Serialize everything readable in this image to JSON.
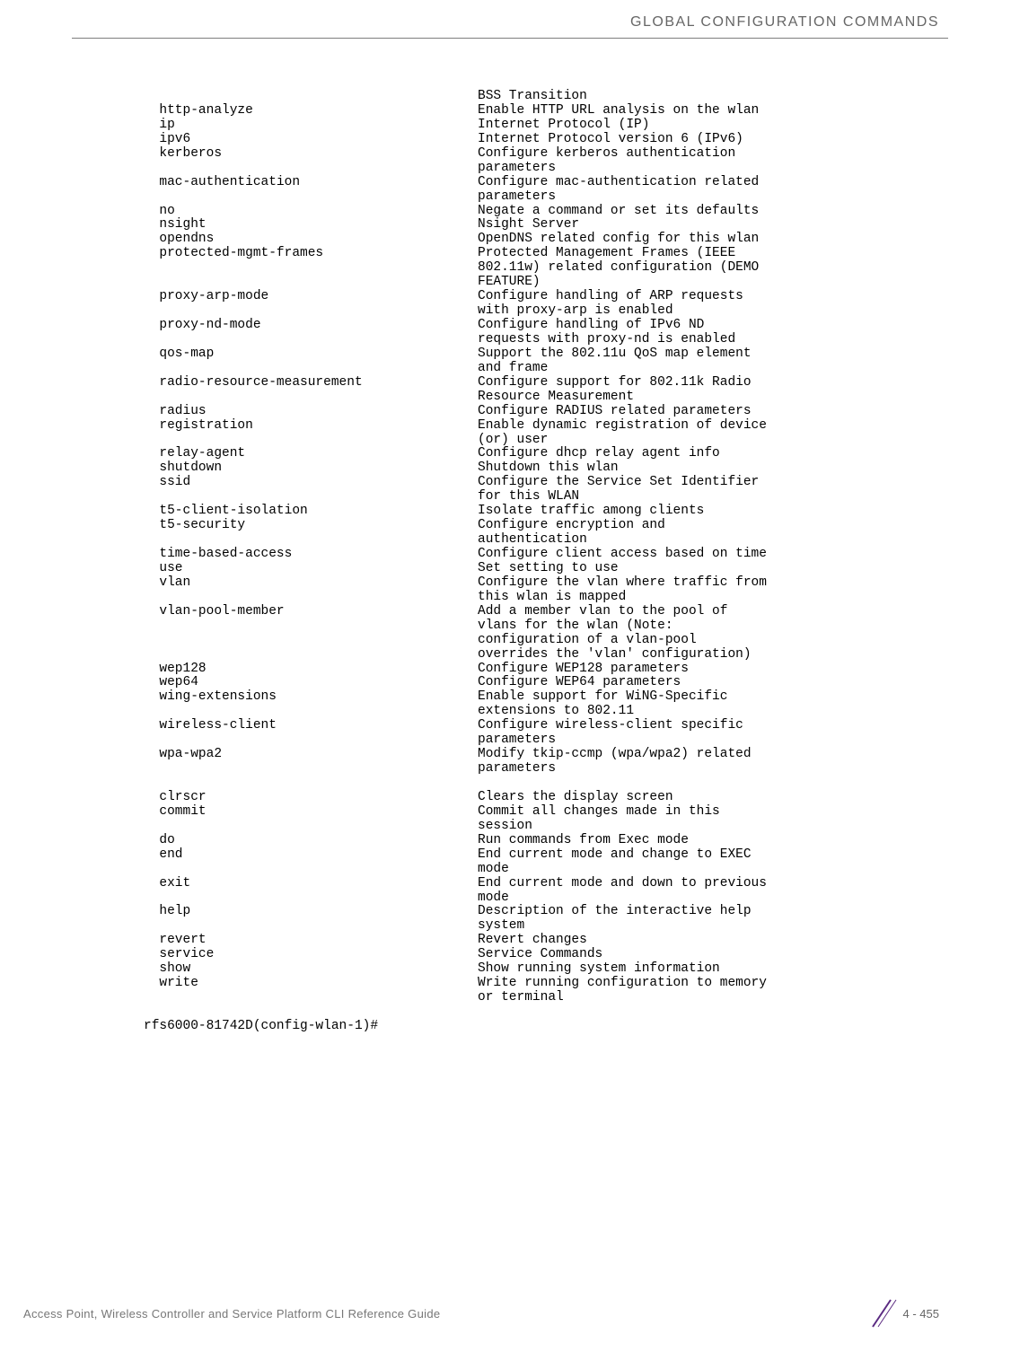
{
  "header": {
    "title": "GLOBAL CONFIGURATION COMMANDS"
  },
  "commands": [
    {
      "name": "",
      "desc": "BSS Transition"
    },
    {
      "name": "http-analyze",
      "desc": "Enable HTTP URL analysis on the wlan"
    },
    {
      "name": "ip",
      "desc": "Internet Protocol (IP)"
    },
    {
      "name": "ipv6",
      "desc": "Internet Protocol version 6 (IPv6)"
    },
    {
      "name": "kerberos",
      "desc": "Configure kerberos authentication\nparameters"
    },
    {
      "name": "mac-authentication",
      "desc": "Configure mac-authentication related\nparameters"
    },
    {
      "name": "no",
      "desc": "Negate a command or set its defaults"
    },
    {
      "name": "nsight",
      "desc": "Nsight Server"
    },
    {
      "name": "opendns",
      "desc": "OpenDNS related config for this wlan"
    },
    {
      "name": "protected-mgmt-frames",
      "desc": "Protected Management Frames (IEEE\n802.11w) related configuration (DEMO\nFEATURE)"
    },
    {
      "name": "proxy-arp-mode",
      "desc": "Configure handling of ARP requests\nwith proxy-arp is enabled"
    },
    {
      "name": "proxy-nd-mode",
      "desc": "Configure handling of IPv6 ND\nrequests with proxy-nd is enabled"
    },
    {
      "name": "qos-map",
      "desc": "Support the 802.11u QoS map element\nand frame"
    },
    {
      "name": "radio-resource-measurement",
      "desc": "Configure support for 802.11k Radio\nResource Measurement"
    },
    {
      "name": "radius",
      "desc": "Configure RADIUS related parameters"
    },
    {
      "name": "registration",
      "desc": "Enable dynamic registration of device\n(or) user"
    },
    {
      "name": "relay-agent",
      "desc": "Configure dhcp relay agent info"
    },
    {
      "name": "shutdown",
      "desc": "Shutdown this wlan"
    },
    {
      "name": "ssid",
      "desc": "Configure the Service Set Identifier\nfor this WLAN"
    },
    {
      "name": "t5-client-isolation",
      "desc": "Isolate traffic among clients"
    },
    {
      "name": "t5-security",
      "desc": "Configure encryption and\nauthentication"
    },
    {
      "name": "time-based-access",
      "desc": "Configure client access based on time"
    },
    {
      "name": "use",
      "desc": "Set setting to use"
    },
    {
      "name": "vlan",
      "desc": "Configure the vlan where traffic from\nthis wlan is mapped"
    },
    {
      "name": "vlan-pool-member",
      "desc": "Add a member vlan to the pool of\nvlans for the wlan (Note:\nconfiguration of a vlan-pool\noverrides the 'vlan' configuration)"
    },
    {
      "name": "wep128",
      "desc": "Configure WEP128 parameters"
    },
    {
      "name": "wep64",
      "desc": "Configure WEP64 parameters"
    },
    {
      "name": "wing-extensions",
      "desc": "Enable support for WiNG-Specific\nextensions to 802.11"
    },
    {
      "name": "wireless-client",
      "desc": "Configure wireless-client specific\nparameters"
    },
    {
      "name": "wpa-wpa2",
      "desc": "Modify tkip-ccmp (wpa/wpa2) related\nparameters"
    },
    {
      "name": "",
      "desc": ""
    },
    {
      "name": "clrscr",
      "desc": "Clears the display screen"
    },
    {
      "name": "commit",
      "desc": "Commit all changes made in this\nsession"
    },
    {
      "name": "do",
      "desc": "Run commands from Exec mode"
    },
    {
      "name": "end",
      "desc": "End current mode and change to EXEC\nmode"
    },
    {
      "name": "exit",
      "desc": "End current mode and down to previous\nmode"
    },
    {
      "name": "help",
      "desc": "Description of the interactive help\nsystem"
    },
    {
      "name": "revert",
      "desc": "Revert changes"
    },
    {
      "name": "service",
      "desc": "Service Commands"
    },
    {
      "name": "show",
      "desc": "Show running system information"
    },
    {
      "name": "write",
      "desc": "Write running configuration to memory\nor terminal"
    }
  ],
  "prompt": "rfs6000-81742D(config-wlan-1)#",
  "footer": {
    "left": "Access Point, Wireless Controller and Service Platform CLI Reference Guide",
    "page": "4 - 455"
  }
}
